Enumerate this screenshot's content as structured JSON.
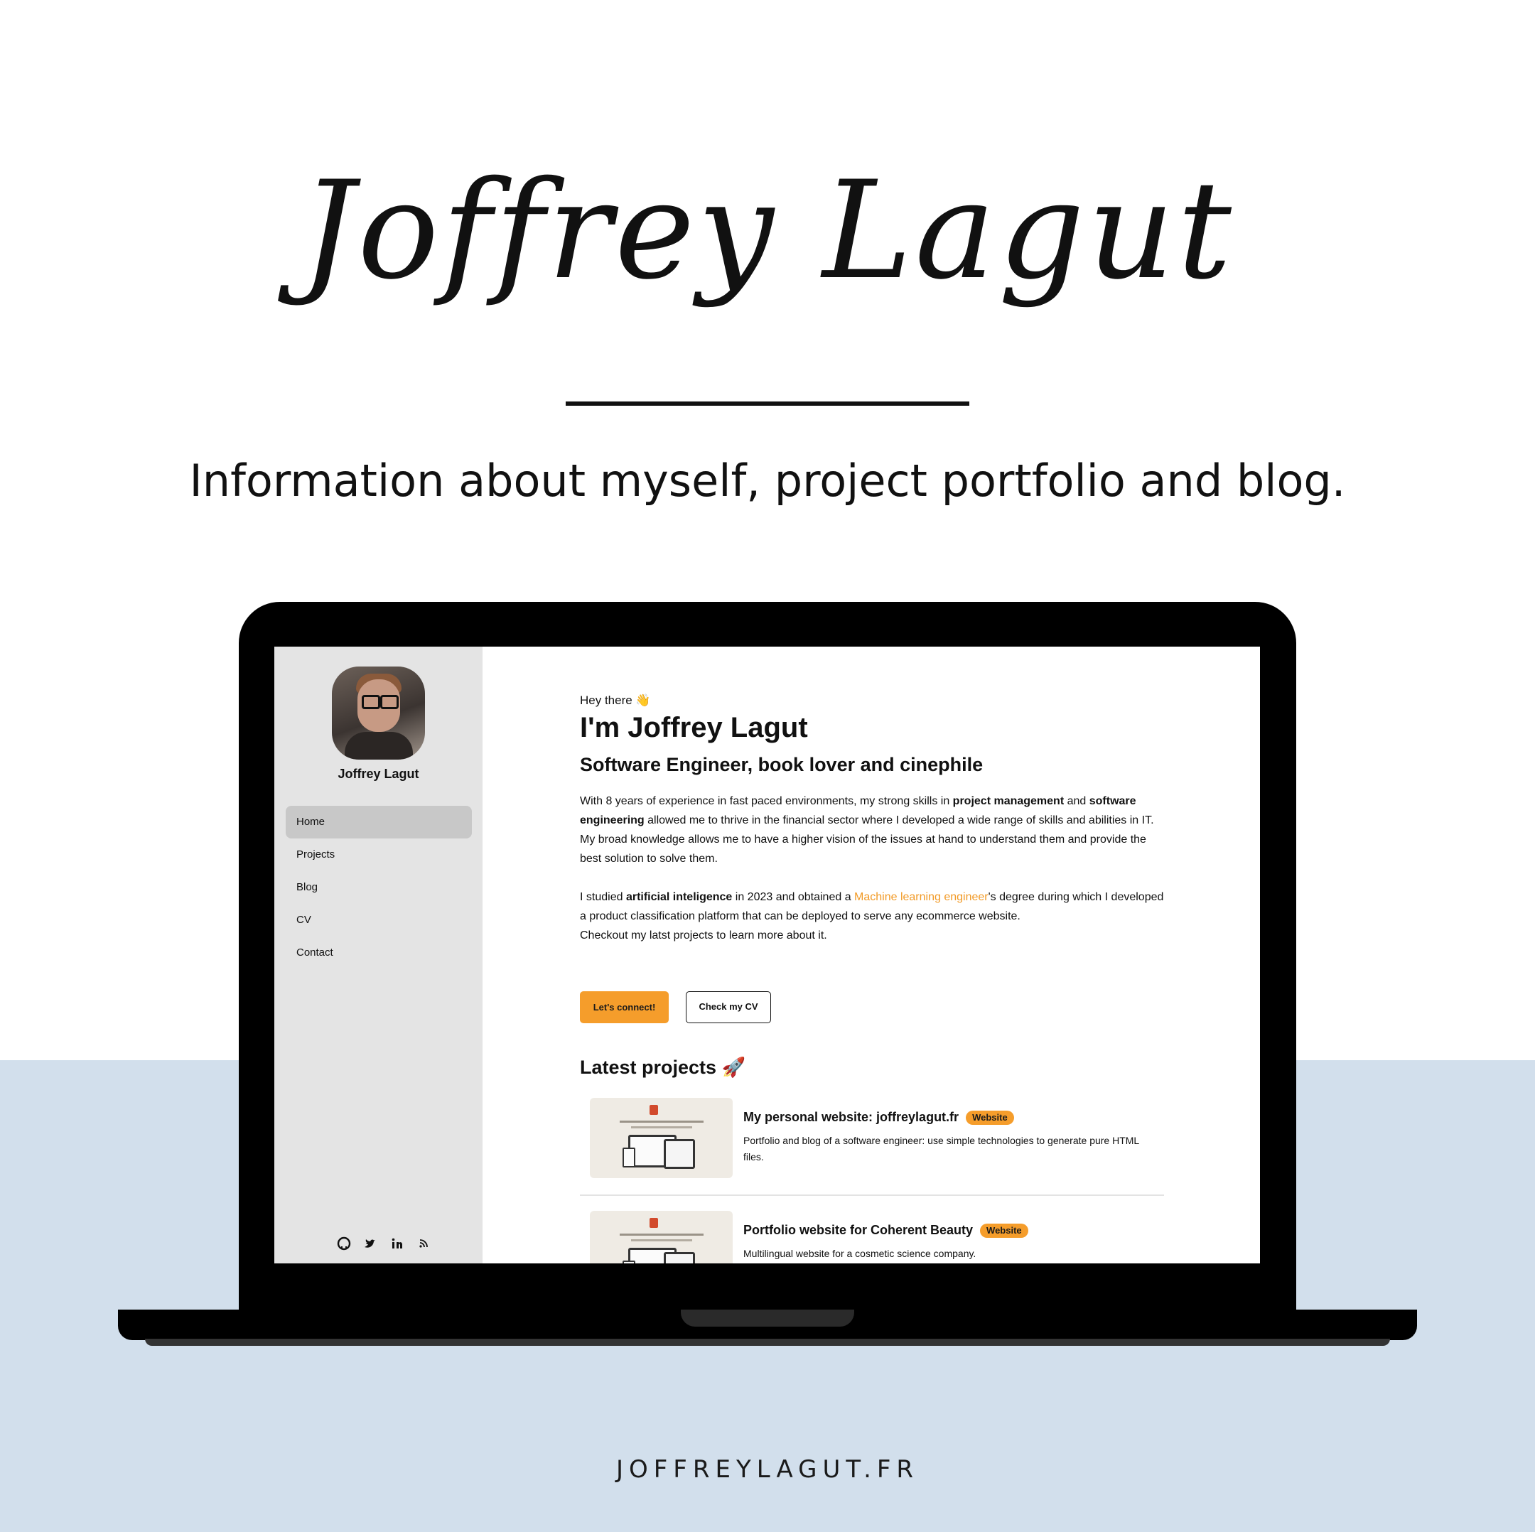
{
  "poster": {
    "script_title": "Joffrey Lagut",
    "tagline": "Information about myself, project portfolio and blog.",
    "footer_url": "JOFFREYLAGUT.FR"
  },
  "sidebar": {
    "name": "Joffrey Lagut",
    "nav": [
      {
        "label": "Home",
        "active": true
      },
      {
        "label": "Projects"
      },
      {
        "label": "Blog"
      },
      {
        "label": "CV"
      },
      {
        "label": "Contact"
      }
    ],
    "social_icons": [
      "github-icon",
      "twitter-icon",
      "linkedin-icon",
      "rss-icon"
    ]
  },
  "main": {
    "greeting": "Hey there 👋",
    "heading": "I'm Joffrey Lagut",
    "subheading": "Software Engineer, book lover and cinephile",
    "intro": {
      "p1_a": "With 8 years of experience in fast paced environments, my strong skills in ",
      "p1_b1": "project management",
      "p1_c": " and ",
      "p1_b2": "software engineering",
      "p1_d": " allowed me to thrive in the financial sector where I developed a wide range of skills and abilities in IT.",
      "p2": "My broad knowledge allows me to have a higher vision of the issues at hand to understand them and provide the best solution to solve them.",
      "p3_a": "I studied ",
      "p3_b": "artificial inteligence",
      "p3_c": " in 2023 and obtained a ",
      "p3_link": "Machine learning engineer",
      "p3_d": "'s degree during which I developed a product classification platform that can be deployed to serve any ecommerce website.",
      "p4": "Checkout my latst projects to learn more about it."
    },
    "buttons": {
      "connect": "Let's connect!",
      "cv": "Check my CV"
    },
    "latest_heading": "Latest projects 🚀",
    "projects": [
      {
        "title": "My personal website: joffreylagut.fr",
        "badge": "Website",
        "description": "Portfolio and blog of a software engineer: use simple technologies to generate pure HTML files."
      },
      {
        "title": "Portfolio website for Coherent Beauty",
        "badge": "Website",
        "description": "Multilingual website for a cosmetic science company."
      }
    ]
  },
  "colors": {
    "accent": "#f59d2b",
    "bottom_band": "#d2dfec",
    "sidebar_bg": "#e4e4e4",
    "nav_active": "#c8c8c8"
  }
}
